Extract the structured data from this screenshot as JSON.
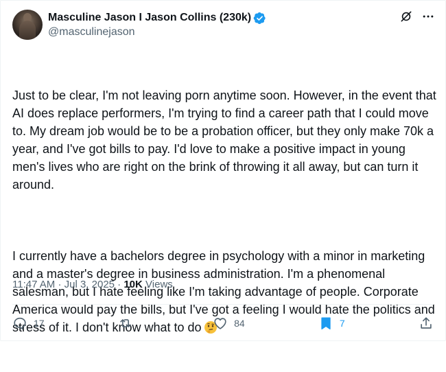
{
  "author": {
    "display_name": "Masculine Jason I Jason Collins (230k)",
    "handle": "@masculinejason",
    "verified": true
  },
  "tweet": {
    "paragraph_1": "Just to be clear, I'm not leaving porn anytime soon. However, in the event that AI does replace performers, I'm trying to find a career path that I could move to. My dream job would be to be a probation officer, but they only make 70k a year, and I've got bills to pay. I'd love to make a positive impact in young men's lives who are right on the brink of throwing it all away, but can turn it around.",
    "paragraph_2": "I currently have a bachelors degree in psychology with a minor in marketing and a master's degree in business administration. I'm a phenomenal salesman, but I hate feeling like I'm taking advantage of people. Corporate America would pay the bills, but I've got a feeling I would hate the politics and stress of it. I don't know what to do",
    "emoji": "thinking-face"
  },
  "meta": {
    "time": "11:47 AM",
    "separator": "·",
    "date": "Jul 3, 2025",
    "views_count": "10K",
    "views_label": "Views"
  },
  "actions": {
    "replies": "17",
    "reposts": "",
    "likes": "84",
    "bookmarks": "7"
  },
  "colors": {
    "text": "#0f1419",
    "secondary": "#536471",
    "accent": "#1d9bf0",
    "divider": "#eff3f4"
  },
  "icons": [
    "grok-icon",
    "more-icon",
    "reply-icon",
    "repost-icon",
    "like-icon",
    "bookmark-icon",
    "share-icon",
    "verified-badge-icon"
  ]
}
